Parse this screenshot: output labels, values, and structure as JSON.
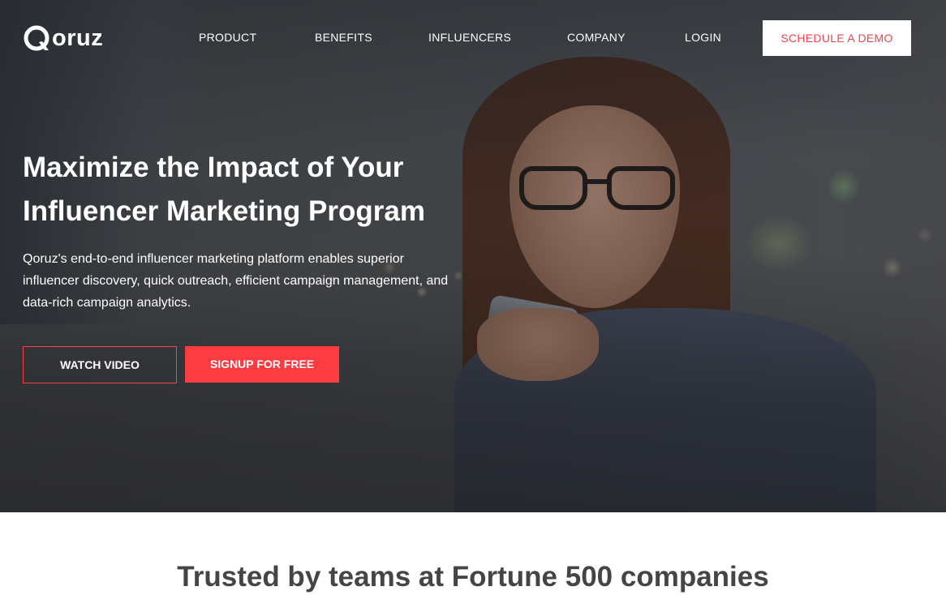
{
  "brand": {
    "name": "oruz",
    "accent": "#f0444c",
    "signup_bg": "#fc3b42"
  },
  "nav": {
    "items": [
      {
        "label": "PRODUCT"
      },
      {
        "label": "BENEFITS"
      },
      {
        "label": "INFLUENCERS"
      },
      {
        "label": "COMPANY"
      },
      {
        "label": "LOGIN"
      }
    ],
    "cta_label": "SCHEDULE A DEMO"
  },
  "hero": {
    "headline_line1": "Maximize the Impact of Your",
    "headline_line2": "Influencer Marketing Program",
    "subtext": "Qoruz's end-to-end influencer marketing platform enables superior influencer discovery, quick outreach, efficient campaign management, and data-rich campaign analytics.",
    "watch_label": "WATCH VIDEO",
    "signup_label": "SIGNUP FOR FREE",
    "image_subject": "woman-with-glasses-using-phone"
  },
  "trusted": {
    "heading": "Trusted by teams at Fortune 500 companies"
  }
}
